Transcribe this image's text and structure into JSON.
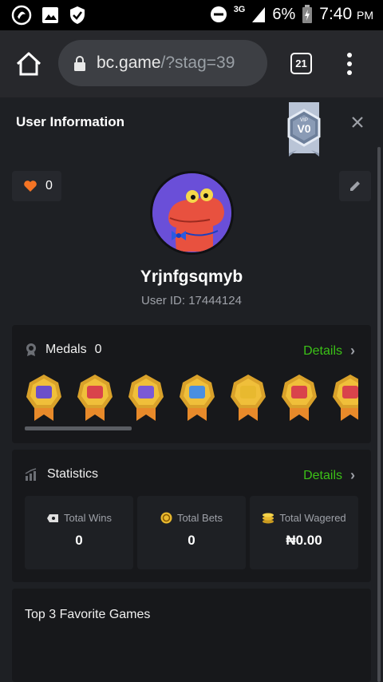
{
  "status_bar": {
    "network": "3G",
    "battery": "6%",
    "time": "7:40",
    "ampm": "PM"
  },
  "browser": {
    "domain": "bc.game",
    "path": "/?stag=39",
    "tab_count": "21"
  },
  "header": {
    "title": "User Information",
    "vip_label": "VIP",
    "vip_level": "V0"
  },
  "profile": {
    "likes": "0",
    "username": "Yrjnfgsqmyb",
    "user_id": "User ID: 17444124"
  },
  "medals": {
    "title": "Medals",
    "count": "0",
    "details_label": "Details",
    "scroll_progress": 0.32,
    "items": [
      {
        "icon": "chat-medal-icon",
        "color": "#6b4fc9"
      },
      {
        "icon": "heart-medal-icon",
        "color": "#d9434b"
      },
      {
        "icon": "wallet-medal-icon",
        "color": "#7b59d6"
      },
      {
        "icon": "thumbs-up-medal-icon",
        "color": "#4a8fe0"
      },
      {
        "icon": "coin-medal-icon",
        "color": "#e8b92f"
      },
      {
        "icon": "trophy-medal-icon",
        "color": "#d9434b"
      },
      {
        "icon": "gift-medal-icon",
        "color": "#d9434b"
      }
    ]
  },
  "statistics": {
    "title": "Statistics",
    "details_label": "Details",
    "total_wins_label": "Total Wins",
    "total_wins": "0",
    "total_bets_label": "Total Bets",
    "total_bets": "0",
    "total_wagered_label": "Total Wagered",
    "total_wagered": "₦0.00"
  },
  "favorites": {
    "title": "Top 3 Favorite Games"
  },
  "colors": {
    "accent_green": "#3bc117",
    "heart_orange": "#f57424",
    "card_bg": "#17181b",
    "page_bg": "#1e2024"
  }
}
